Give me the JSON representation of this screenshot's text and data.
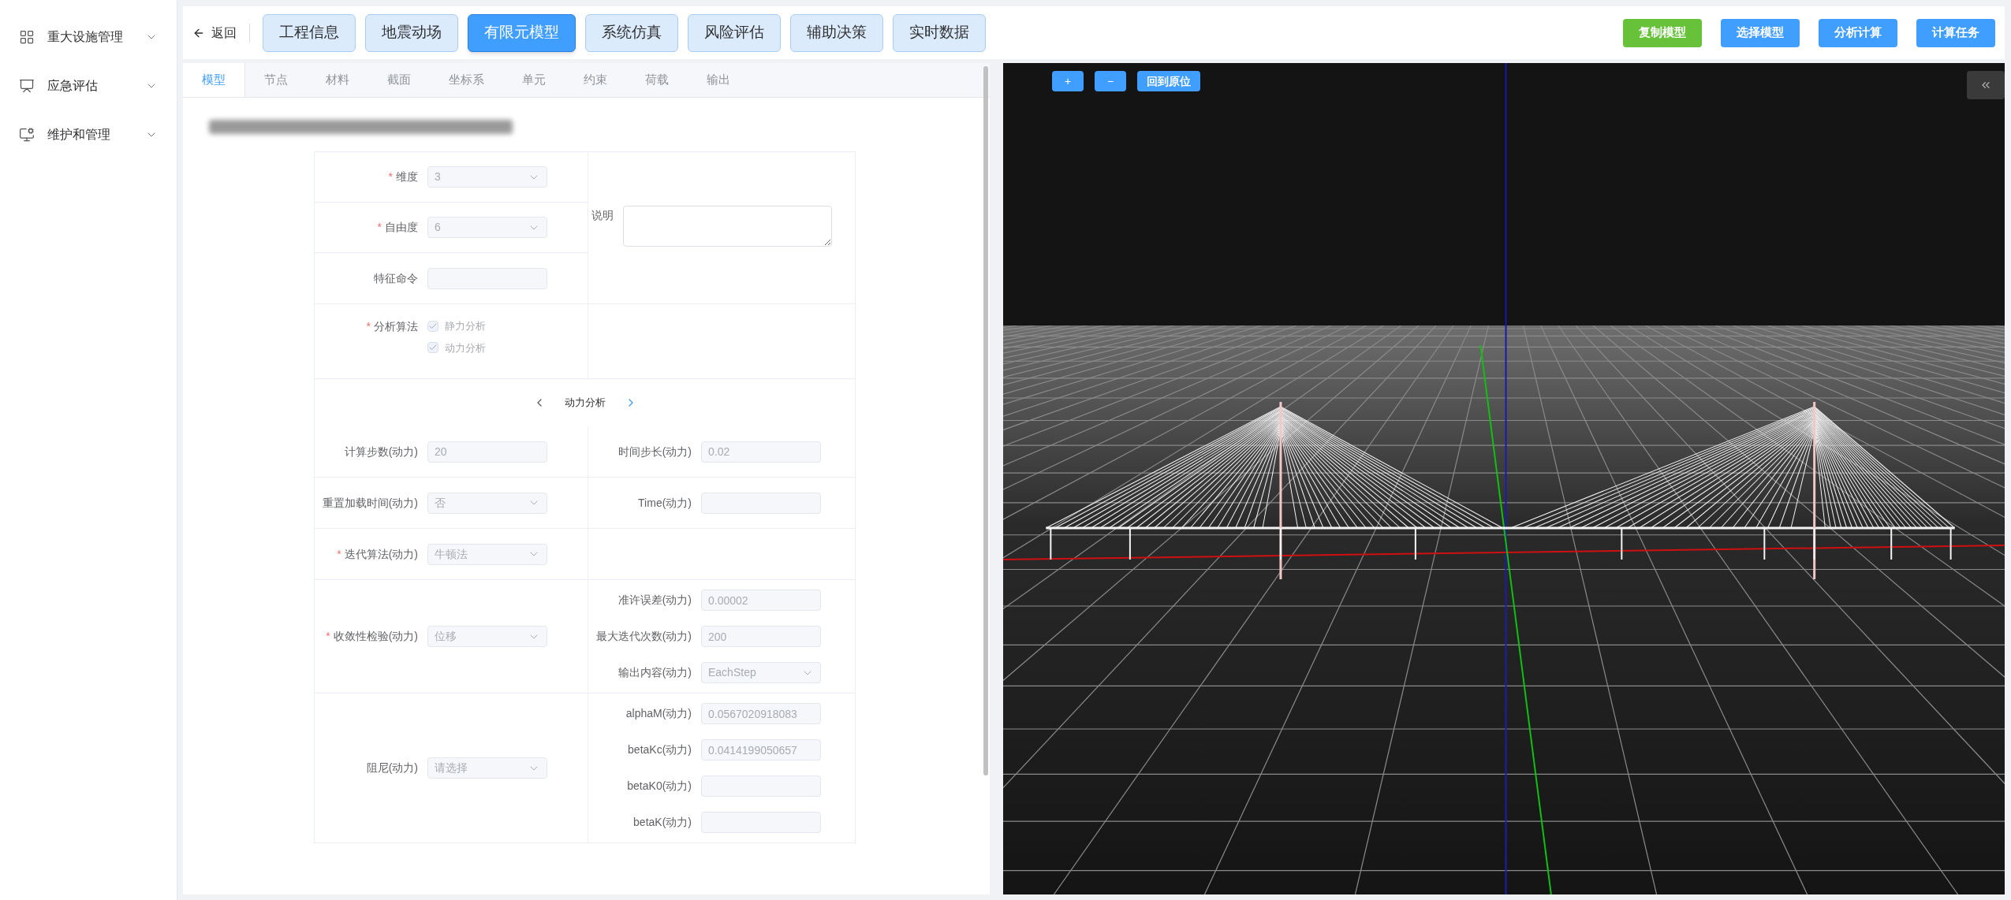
{
  "sidebar": {
    "items": [
      {
        "label": "重大设施管理",
        "expanded": false
      },
      {
        "label": "应急评估",
        "expanded": false
      },
      {
        "label": "维护和管理",
        "expanded": false
      }
    ]
  },
  "top_bar": {
    "back": "返回",
    "nav": [
      {
        "label": "工程信息",
        "selected": false
      },
      {
        "label": "地震动场",
        "selected": false
      },
      {
        "label": "有限元模型",
        "selected": true
      },
      {
        "label": "系统仿真",
        "selected": false
      },
      {
        "label": "风险评估",
        "selected": false
      },
      {
        "label": "辅助决策",
        "selected": false
      },
      {
        "label": "实时数据",
        "selected": false
      }
    ],
    "actions": [
      {
        "label": "复制模型",
        "color": "#67c23a"
      },
      {
        "label": "选择模型",
        "color": "#409eff"
      },
      {
        "label": "分析计算",
        "color": "#409eff"
      },
      {
        "label": "计算任务",
        "color": "#409eff"
      }
    ]
  },
  "tabs": [
    {
      "label": "模型",
      "selected": true
    },
    {
      "label": "节点",
      "selected": false
    },
    {
      "label": "材料",
      "selected": false
    },
    {
      "label": "截面",
      "selected": false
    },
    {
      "label": "坐标系",
      "selected": false
    },
    {
      "label": "单元",
      "selected": false
    },
    {
      "label": "约束",
      "selected": false
    },
    {
      "label": "荷载",
      "selected": false
    },
    {
      "label": "输出",
      "selected": false
    }
  ],
  "form": {
    "top_left": [
      {
        "kind": "select",
        "label": "维度",
        "marker": "*",
        "value": "3"
      },
      {
        "kind": "select",
        "label": "自由度",
        "marker": "*",
        "value": "6"
      },
      {
        "kind": "input",
        "label": "特征命令"
      }
    ],
    "note": {
      "label": "说明"
    },
    "algorithm": {
      "label": "分析算法",
      "marker": "*",
      "options": [
        {
          "label": "静力分析",
          "checked": true
        },
        {
          "label": "动力分析",
          "checked": true
        }
      ]
    },
    "section_nav": {
      "title": "动力分析"
    },
    "rows": [
      {
        "left": {
          "kind": "input",
          "label": "计算步数(动力)",
          "value": "20"
        },
        "right": [
          {
            "kind": "input",
            "label": "时间步长(动力)",
            "value": "0.02"
          }
        ]
      },
      {
        "left": {
          "kind": "select",
          "label": "重置加载时间(动力)",
          "value": "否"
        },
        "right": [
          {
            "kind": "input",
            "label": "Time(动力)"
          }
        ]
      },
      {
        "left": {
          "kind": "select",
          "label": "迭代算法(动力)",
          "marker": "*",
          "value": "牛顿法"
        },
        "right": []
      },
      {
        "left": {
          "kind": "select",
          "label": "收敛性检验(动力)",
          "marker": "*",
          "value": "位移"
        },
        "right": [
          {
            "kind": "input",
            "label": "准许误差(动力)",
            "value": "0.00002"
          },
          {
            "kind": "input",
            "label": "最大迭代次数(动力)",
            "value": "200"
          },
          {
            "kind": "select",
            "label": "输出内容(动力)",
            "value": "EachStep"
          }
        ]
      },
      {
        "left": {
          "kind": "select",
          "label": "阻尼(动力)",
          "placeholder": "请选择"
        },
        "right": [
          {
            "kind": "input",
            "label": "alphaM(动力)",
            "value": "0.0567020918083"
          },
          {
            "kind": "input",
            "label": "betaKc(动力)",
            "value": "0.0414199050657"
          },
          {
            "kind": "input",
            "label": "betaK0(动力)"
          },
          {
            "kind": "input",
            "label": "betaK(动力)"
          }
        ]
      }
    ]
  },
  "viewer": {
    "controls": [
      {
        "kind": "zoom-in",
        "label": "+"
      },
      {
        "kind": "zoom-out",
        "label": "−"
      },
      {
        "kind": "reset",
        "label": "回到原位"
      }
    ]
  }
}
